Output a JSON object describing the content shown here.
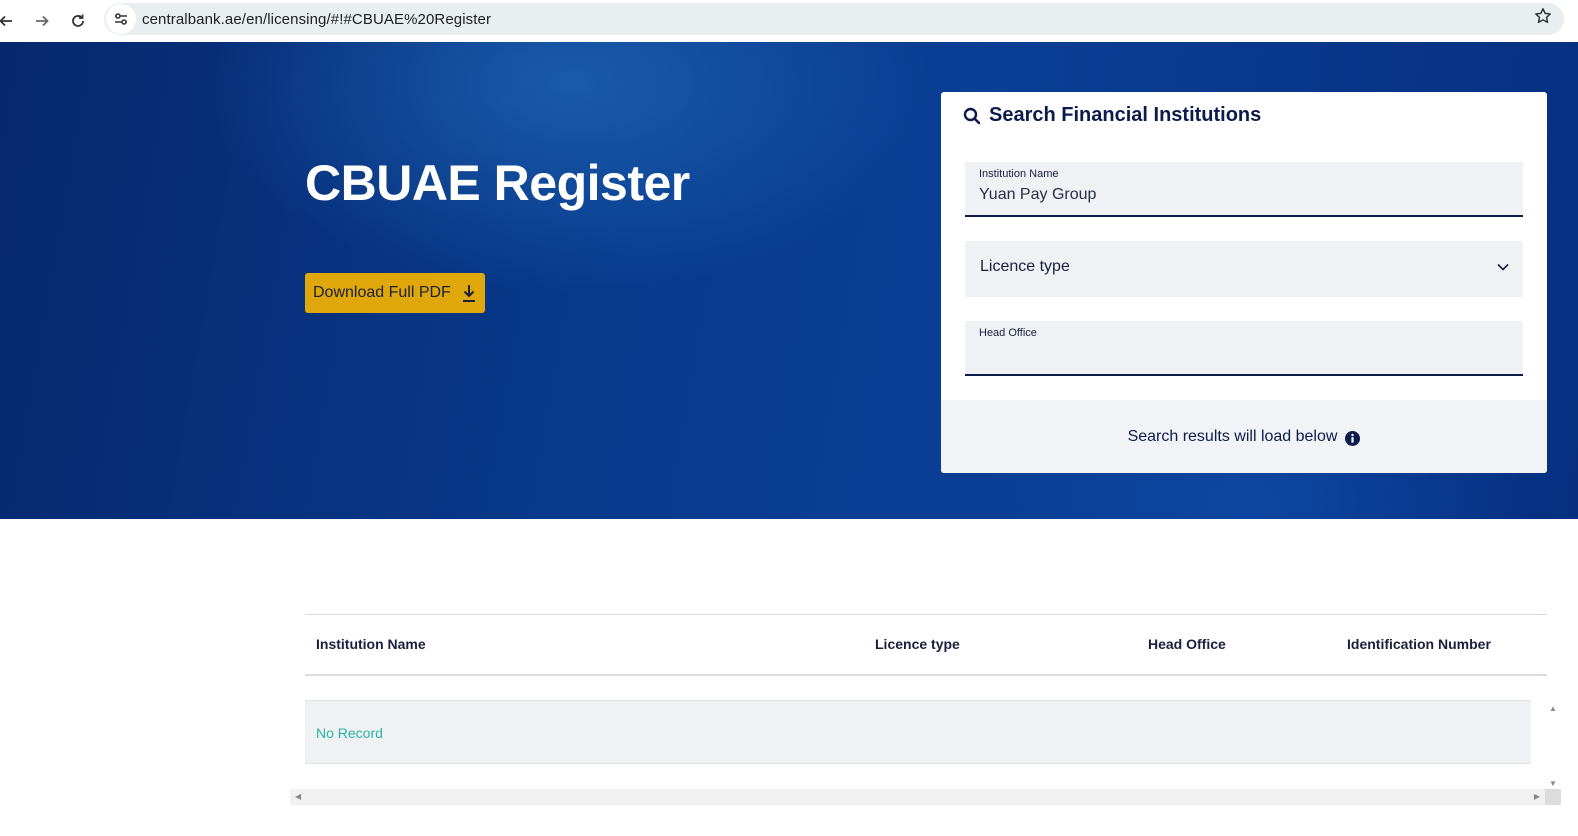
{
  "browser": {
    "url": "centralbank.ae/en/licensing/#!#CBUAE%20Register",
    "back_icon": "arrow-left-icon",
    "forward_icon": "arrow-right-icon",
    "reload_icon": "reload-icon",
    "site_info_icon": "tune-icon",
    "bookmark_icon": "star-icon"
  },
  "hero": {
    "title": "CBUAE Register",
    "download_label": "Download Full PDF",
    "download_icon": "download-icon"
  },
  "search": {
    "title": "Search Financial Institutions",
    "institution_name": {
      "label": "Institution Name",
      "value": "Yuan Pay Group"
    },
    "licence_type": {
      "value": "Licence type"
    },
    "head_office": {
      "label": "Head Office",
      "value": ""
    },
    "footer_text": "Search results will load below"
  },
  "table": {
    "columns": [
      "Institution Name",
      "Licence type",
      "Head Office",
      "Identification Number"
    ],
    "empty_text": "No Record"
  },
  "colors": {
    "hero_blue": "#083a8c",
    "accent_gold": "#e0a70b",
    "navy_text": "#0d1b4b",
    "empty_teal": "#2bb5a0"
  }
}
